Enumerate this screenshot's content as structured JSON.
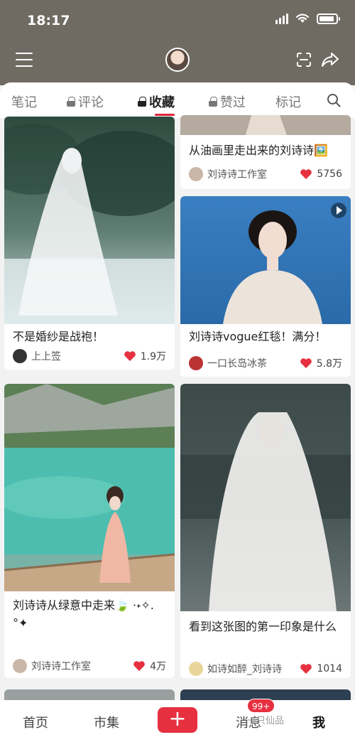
{
  "status_bar": {
    "time": "18:17"
  },
  "tabs": [
    {
      "label": "笔记",
      "locked": false,
      "active": false
    },
    {
      "label": "评论",
      "locked": true,
      "active": false
    },
    {
      "label": "收藏",
      "locked": true,
      "active": true
    },
    {
      "label": "赞过",
      "locked": true,
      "active": false
    },
    {
      "label": "标记",
      "locked": false,
      "active": false
    }
  ],
  "cards": [
    {
      "title": "从油画里走出来的刘诗诗🖼️",
      "author": "刘诗诗工作室",
      "likes": "5756"
    },
    {
      "title": "不是婚纱是战袍！",
      "author": "上上签",
      "likes": "1.9万"
    },
    {
      "title": "刘诗诗vogue红毯！满分！",
      "author": "一口长岛冰茶",
      "likes": "5.8万"
    },
    {
      "title": "刘诗诗从绿意中走来🍃 ·˖✧.°✦",
      "author": "刘诗诗工作室",
      "likes": "4万"
    },
    {
      "title": "看到这张图的第一印象是什么",
      "author": "如诗如醉_刘诗诗",
      "likes": "1014"
    }
  ],
  "bottom_nav": {
    "home": "首页",
    "market": "市集",
    "publish": "+",
    "messages": "消息",
    "messages_badge": "99+",
    "me": "我",
    "watermark": "一只仙品"
  },
  "colors": {
    "accent": "#e0233b",
    "header": "#6f6b63"
  },
  "icons": [
    "menu-icon",
    "scan-icon",
    "share-icon",
    "lock-icon",
    "search-icon",
    "heart-icon",
    "video-play-icon"
  ]
}
